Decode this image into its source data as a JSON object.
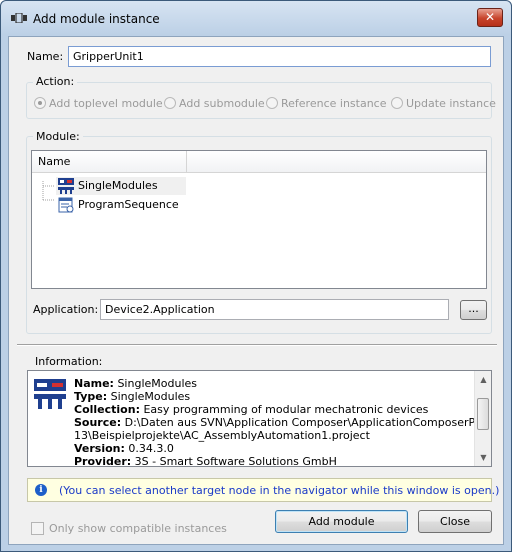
{
  "window": {
    "title": "Add module instance",
    "close_glyph": "✕"
  },
  "name_field": {
    "label": "Name:",
    "value": "GripperUnit1"
  },
  "action": {
    "title": "Action:",
    "options": [
      {
        "label": "Add toplevel module",
        "selected": true
      },
      {
        "label": "Add submodule",
        "selected": false
      },
      {
        "label": "Reference instance",
        "selected": false
      },
      {
        "label": "Update instance",
        "selected": false
      }
    ]
  },
  "module": {
    "title": "Module:",
    "column_header": "Name",
    "items": [
      {
        "label": "SingleModules",
        "icon": "module-set-icon"
      },
      {
        "label": "ProgramSequence",
        "icon": "program-sequence-icon"
      }
    ]
  },
  "application": {
    "label": "Application:",
    "value": "Device2.Application",
    "browse_label": "..."
  },
  "information": {
    "title": "Information:",
    "lines": [
      {
        "key": "Name:",
        "value": " SingleModules"
      },
      {
        "key": "Type:",
        "value": " SingleModules"
      },
      {
        "key": "Collection:",
        "value": " Easy programming of modular mechatronic devices"
      },
      {
        "key": "Source:",
        "value": " D:\\Daten aus SVN\\Application Composer\\ApplicationComposerPreview_"
      },
      {
        "key": "",
        "value": "13\\Beispielprojekte\\AC_AssemblyAutomation1.project"
      },
      {
        "key": "Version:",
        "value": " 0.34.3.0"
      },
      {
        "key": "Provider:",
        "value": " 3S - Smart Software Solutions GmbH"
      }
    ]
  },
  "hint": {
    "text": "(You can select another target node in the navigator while this window is open.)"
  },
  "footer": {
    "checkbox_label": "Only show compatible instances",
    "add_button": "Add module",
    "close_button": "Close"
  },
  "colors": {
    "hint_text": "#1a3ac8",
    "disabled_text": "#9a9a9a",
    "close_red": "#c7442b"
  }
}
